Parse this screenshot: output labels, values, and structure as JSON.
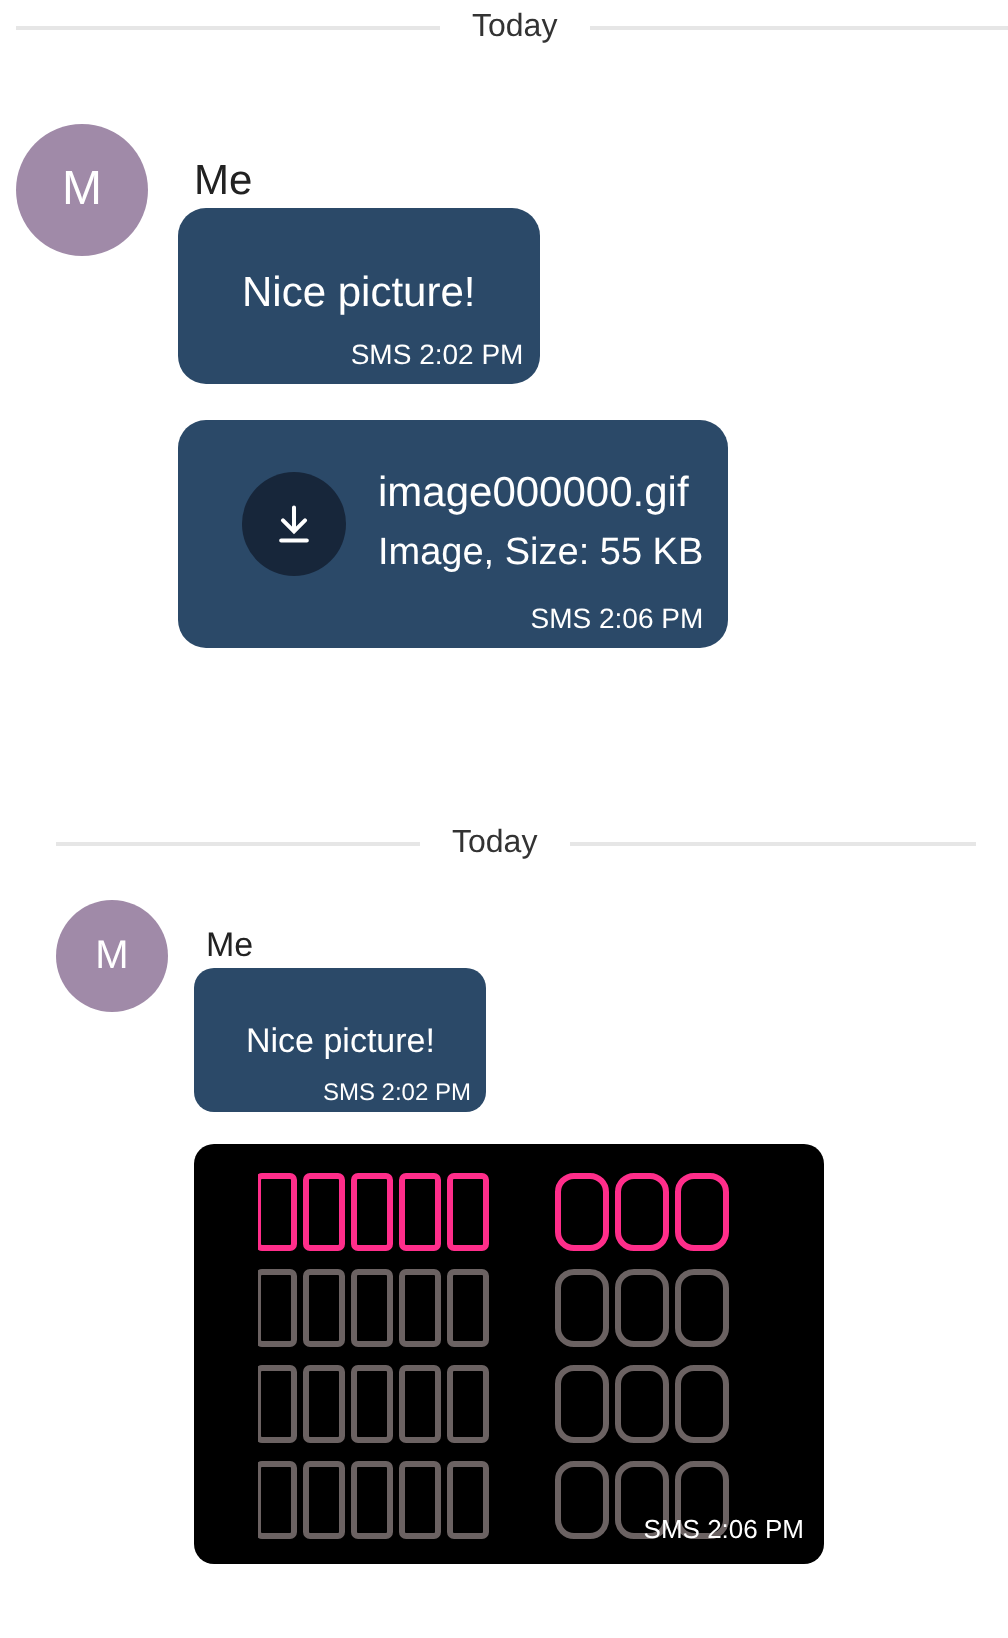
{
  "panels": [
    {
      "date_divider": "Today",
      "sender": {
        "initial": "M",
        "name": "Me"
      },
      "messages": [
        {
          "kind": "text",
          "text": "Nice picture!",
          "meta": "SMS 2:02 PM"
        },
        {
          "kind": "file",
          "file_name": "image000000.gif",
          "file_info": "Image, Size: 55 KB",
          "meta": "SMS 2:06 PM"
        }
      ]
    },
    {
      "date_divider": "Today",
      "sender": {
        "initial": "M",
        "name": "Me"
      },
      "messages": [
        {
          "kind": "text",
          "text": "Nice picture!",
          "meta": "SMS 2:02 PM"
        },
        {
          "kind": "image",
          "meta": "SMS 2:06 PM"
        }
      ]
    }
  ]
}
